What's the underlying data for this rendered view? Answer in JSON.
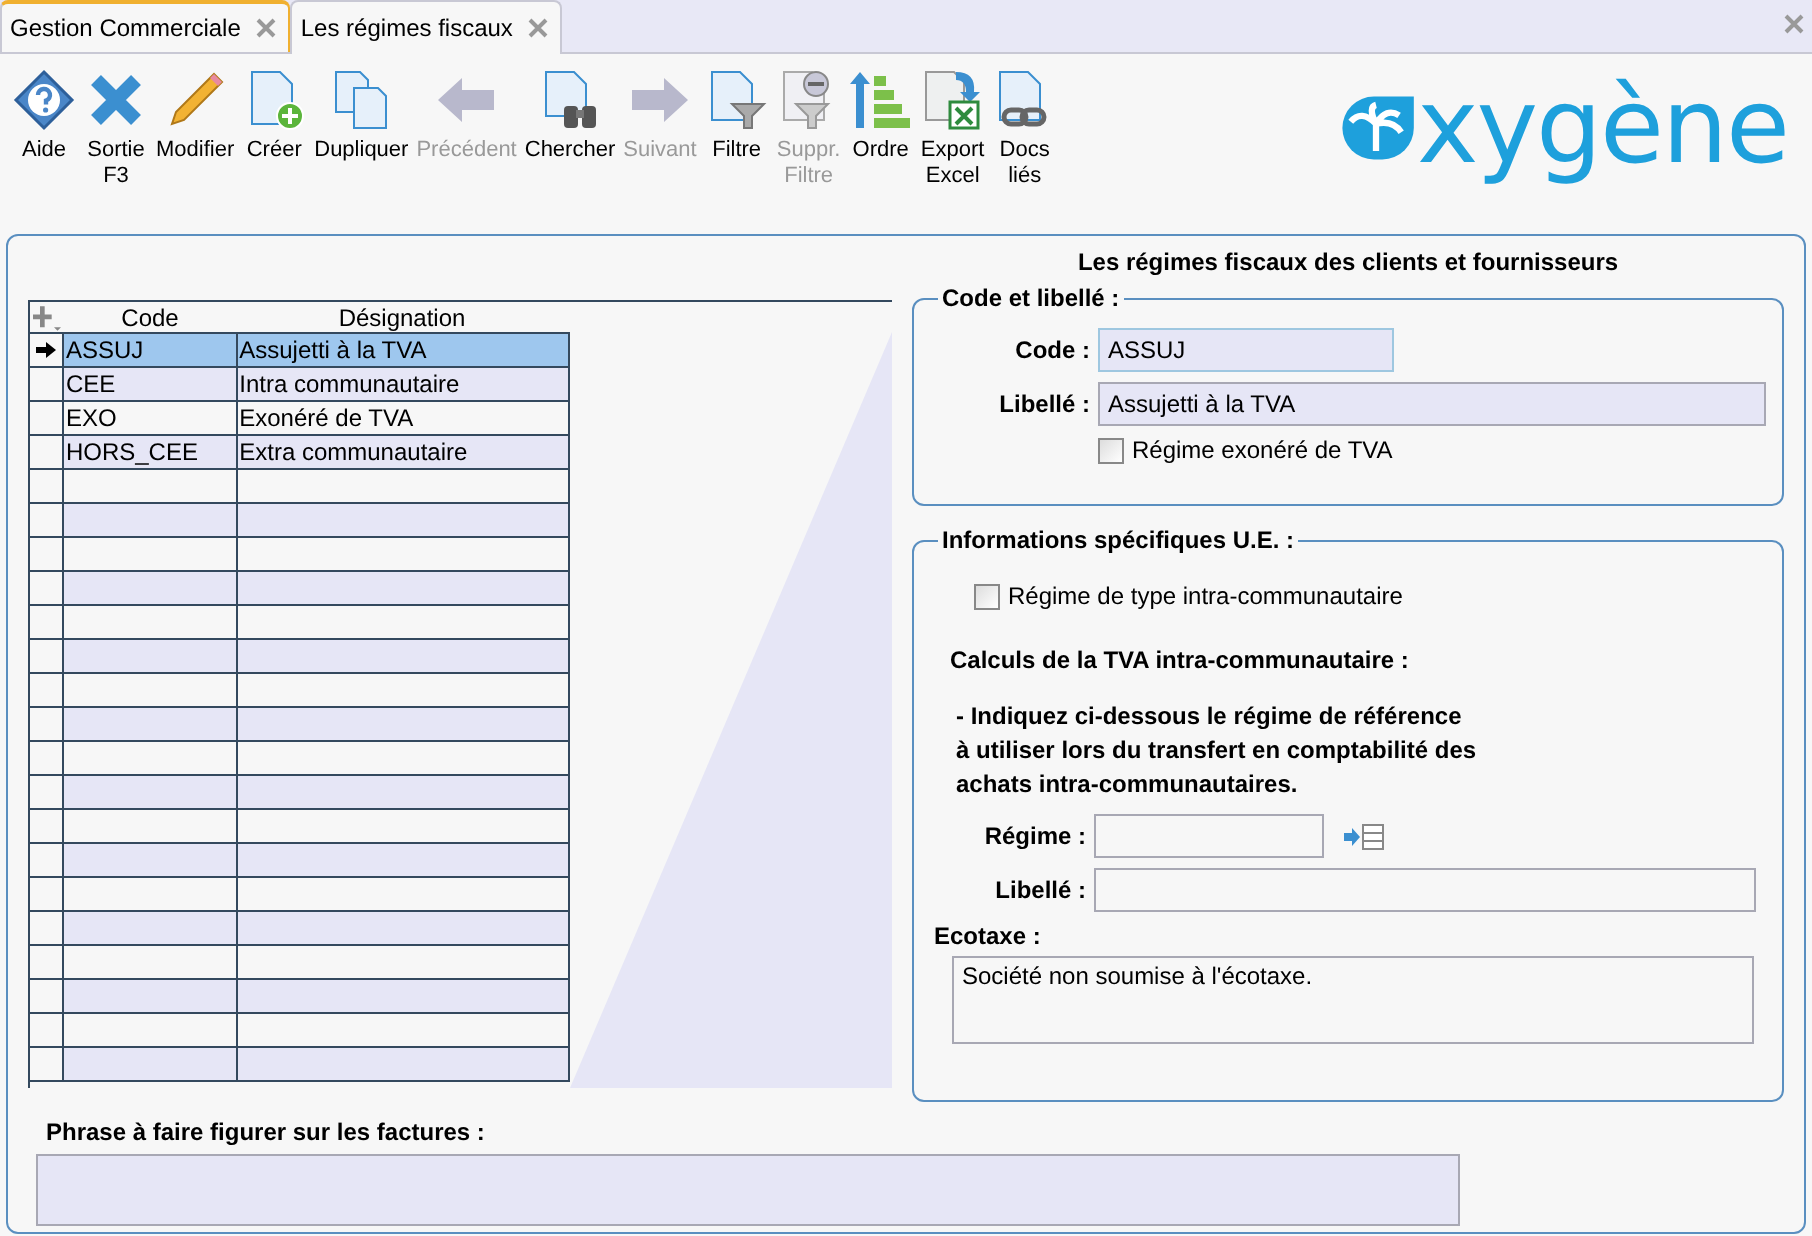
{
  "tabs": [
    {
      "label": "Gestion Commerciale",
      "selected": false
    },
    {
      "label": "Les régimes fiscaux",
      "selected": true
    }
  ],
  "toolbar": [
    {
      "label": "Aide",
      "disabled": false
    },
    {
      "label": "Sortie\nF3",
      "disabled": false
    },
    {
      "label": "Modifier",
      "disabled": false
    },
    {
      "label": "Créer",
      "disabled": false
    },
    {
      "label": "Dupliquer",
      "disabled": false
    },
    {
      "label": "Précédent",
      "disabled": true
    },
    {
      "label": "Chercher",
      "disabled": false
    },
    {
      "label": "Suivant",
      "disabled": true
    },
    {
      "label": "Filtre",
      "disabled": false
    },
    {
      "label": "Suppr.\nFiltre",
      "disabled": true
    },
    {
      "label": "Ordre",
      "disabled": false
    },
    {
      "label": "Export\nExcel",
      "disabled": false
    },
    {
      "label": "Docs\nliés",
      "disabled": false
    }
  ],
  "logo": "xygène",
  "title": "Les régimes fiscaux des clients et fournisseurs",
  "table": {
    "columns": [
      "Code",
      "Désignation"
    ],
    "rows": [
      {
        "code": "ASSUJ",
        "designation": "Assujetti à la TVA",
        "selected": true
      },
      {
        "code": "CEE",
        "designation": "Intra communautaire",
        "selected": false
      },
      {
        "code": "EXO",
        "designation": "Exonéré de TVA",
        "selected": false
      },
      {
        "code": "HORS_CEE",
        "designation": "Extra communautaire",
        "selected": false
      }
    ]
  },
  "code_section": {
    "legend": "Code et libellé :",
    "code_label": "Code :",
    "code_value": "ASSUJ",
    "libelle_label": "Libellé :",
    "libelle_value": "Assujetti à la TVA",
    "exonere": {
      "label": "Régime exonéré de TVA",
      "checked": false
    }
  },
  "ue_section": {
    "legend": "Informations spécifiques U.E. :",
    "intra": {
      "label": "Régime de type intra-communautaire",
      "checked": false
    },
    "calc_heading": "Calculs de la TVA intra-communautaire :",
    "instructions": "- Indiquez ci-dessous le régime de référence\nà utiliser lors du transfert en comptabilité des\nachats intra-communautaires.",
    "regime_label": "Régime :",
    "libelle_label": "Libellé :",
    "ecotaxe_label": "Ecotaxe :",
    "ecotaxe_value": "Société non soumise à l'écotaxe."
  },
  "invoice_phrase": {
    "label": "Phrase à faire figurer sur les factures :"
  }
}
